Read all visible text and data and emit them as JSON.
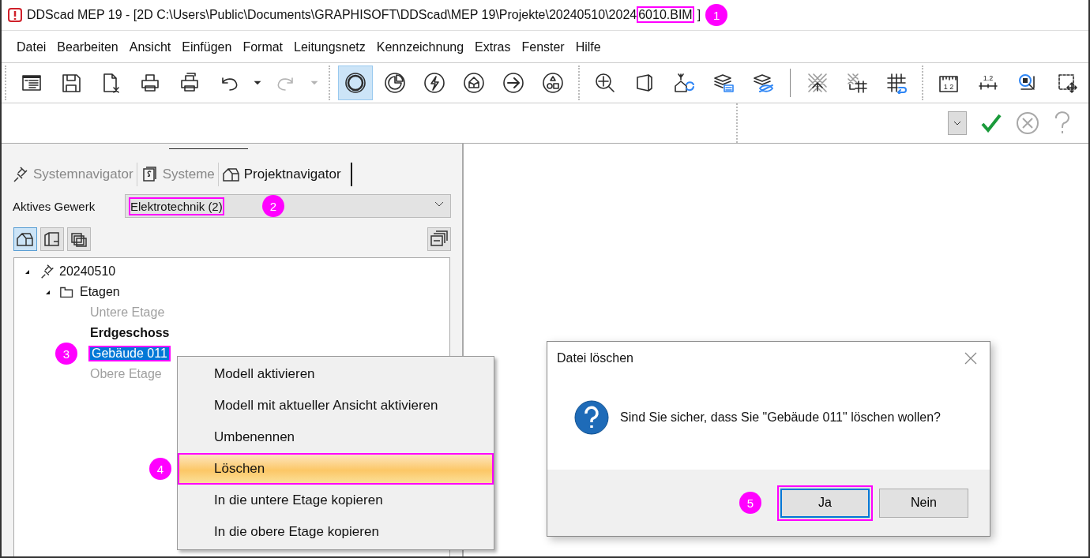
{
  "window": {
    "title_parts": [
      {
        "text": "DDScad MEP 19 - [2D  C:\\Users\\Public\\Documents\\GRAPHISOFT\\DDScad\\MEP 19\\Projekte\\20240510\\2024",
        "highlighted": false
      },
      {
        "text": "6010.BIM",
        "highlighted": true
      },
      {
        "text": "]",
        "highlighted": false
      }
    ],
    "callout": "1"
  },
  "menu_bar": [
    "Datei",
    "Bearbeiten",
    "Ansicht",
    "Einfügen",
    "Format",
    "Leitungsnetz",
    "Kennzeichnung",
    "Extras",
    "Fenster",
    "Hilfe"
  ],
  "toolbar": {
    "groups": [
      {
        "items": [
          {
            "kind": "form",
            "selected": false,
            "disabled": false
          },
          {
            "kind": "save",
            "selected": false,
            "disabled": false
          },
          {
            "kind": "delete-file",
            "selected": false,
            "disabled": false
          },
          {
            "kind": "printer",
            "selected": false,
            "disabled": false
          },
          {
            "kind": "printer-stack",
            "selected": false,
            "disabled": false
          },
          {
            "kind": "undo",
            "selected": false,
            "disabled": false
          },
          {
            "kind": "caret",
            "selected": false,
            "disabled": false
          },
          {
            "kind": "redo",
            "selected": false,
            "disabled": true
          },
          {
            "kind": "caret",
            "selected": false,
            "disabled": true
          }
        ]
      },
      {
        "items": [
          {
            "kind": "ring",
            "selected": true,
            "disabled": false
          },
          {
            "kind": "pie",
            "selected": false,
            "disabled": false
          },
          {
            "kind": "bolt",
            "selected": false,
            "disabled": false
          },
          {
            "kind": "house",
            "selected": false,
            "disabled": false
          },
          {
            "kind": "arrow",
            "selected": false,
            "disabled": false
          },
          {
            "kind": "shapes",
            "selected": false,
            "disabled": false
          }
        ]
      },
      {
        "items": [
          {
            "kind": "zoom",
            "selected": false,
            "disabled": false
          },
          {
            "kind": "box",
            "selected": false,
            "disabled": false
          },
          {
            "kind": "house-sync",
            "selected": false,
            "disabled": false
          },
          {
            "kind": "layers-list",
            "selected": false,
            "disabled": false
          },
          {
            "kind": "layers-hide",
            "selected": false,
            "disabled": false
          },
          {
            "kind": "divider"
          },
          {
            "kind": "hatch-expand",
            "selected": false,
            "disabled": false
          },
          {
            "kind": "hatch-grid",
            "selected": false,
            "disabled": false
          },
          {
            "kind": "grid-sync",
            "selected": false,
            "disabled": false
          }
        ]
      },
      {
        "items": [
          {
            "kind": "ruler",
            "label": "1 2",
            "selected": false,
            "disabled": false
          },
          {
            "kind": "dimension",
            "label": "1.2",
            "selected": false,
            "disabled": false
          },
          {
            "kind": "select-point",
            "selected": false,
            "disabled": false
          },
          {
            "kind": "select-move",
            "selected": false,
            "disabled": false
          }
        ]
      }
    ]
  },
  "action_bar": [
    {
      "kind": "dropdown",
      "disabled": false
    },
    {
      "kind": "confirm",
      "disabled": false
    },
    {
      "kind": "cancel",
      "disabled": true
    },
    {
      "kind": "help",
      "disabled": true
    }
  ],
  "panel": {
    "tabs": [
      {
        "label": "Systemnavigator",
        "kind": "plug",
        "selected": false
      },
      {
        "label": "Systeme",
        "kind": "systems",
        "selected": false
      },
      {
        "label": "Projektnavigator",
        "kind": "building",
        "selected": true
      }
    ],
    "trade": {
      "label": "Aktives Gewerk",
      "value": "Elektrotechnik (2)",
      "highlighted": true,
      "callout": "2"
    },
    "view_buttons": [
      {
        "kind": "building",
        "selected": true
      },
      {
        "kind": "floorplan",
        "selected": false
      },
      {
        "kind": "stack",
        "selected": false
      }
    ],
    "tree": [
      {
        "label": "20240510",
        "kind": "plug",
        "expanded": true,
        "children": [
          {
            "label": "Etagen",
            "kind": "folder",
            "expanded": true,
            "children": [
              {
                "label": "Untere Etage",
                "disabled": true,
                "active": false,
                "selected": false,
                "highlighted": false
              },
              {
                "label": "Erdgeschoss",
                "disabled": false,
                "active": true,
                "selected": false,
                "highlighted": false
              },
              {
                "label": "Gebäude 011",
                "disabled": false,
                "active": false,
                "selected": true,
                "highlighted": true,
                "callout": "3"
              },
              {
                "label": "Obere Etage",
                "disabled": true,
                "active": false,
                "selected": false,
                "highlighted": false
              }
            ]
          }
        ]
      }
    ]
  },
  "context_menu": [
    {
      "label": "Modell aktivieren",
      "selected": false,
      "highlighted": false
    },
    {
      "label": "Modell mit aktueller Ansicht aktivieren",
      "selected": false,
      "highlighted": false
    },
    {
      "label": "Umbenennen",
      "selected": false,
      "highlighted": false
    },
    {
      "label": "Löschen",
      "selected": true,
      "highlighted": true,
      "callout": "4"
    },
    {
      "label": "In die untere Etage kopieren",
      "selected": false,
      "highlighted": false
    },
    {
      "label": "In die obere Etage kopieren",
      "selected": false,
      "highlighted": false
    }
  ],
  "dialog": {
    "title": "Datei löschen",
    "message": "Sind Sie sicher, dass Sie \"Gebäude 011\" löschen wollen?",
    "buttons": [
      {
        "label": "Ja",
        "default": true,
        "highlighted": true,
        "callout": "5"
      },
      {
        "label": "Nein",
        "default": false,
        "highlighted": false
      }
    ]
  }
}
